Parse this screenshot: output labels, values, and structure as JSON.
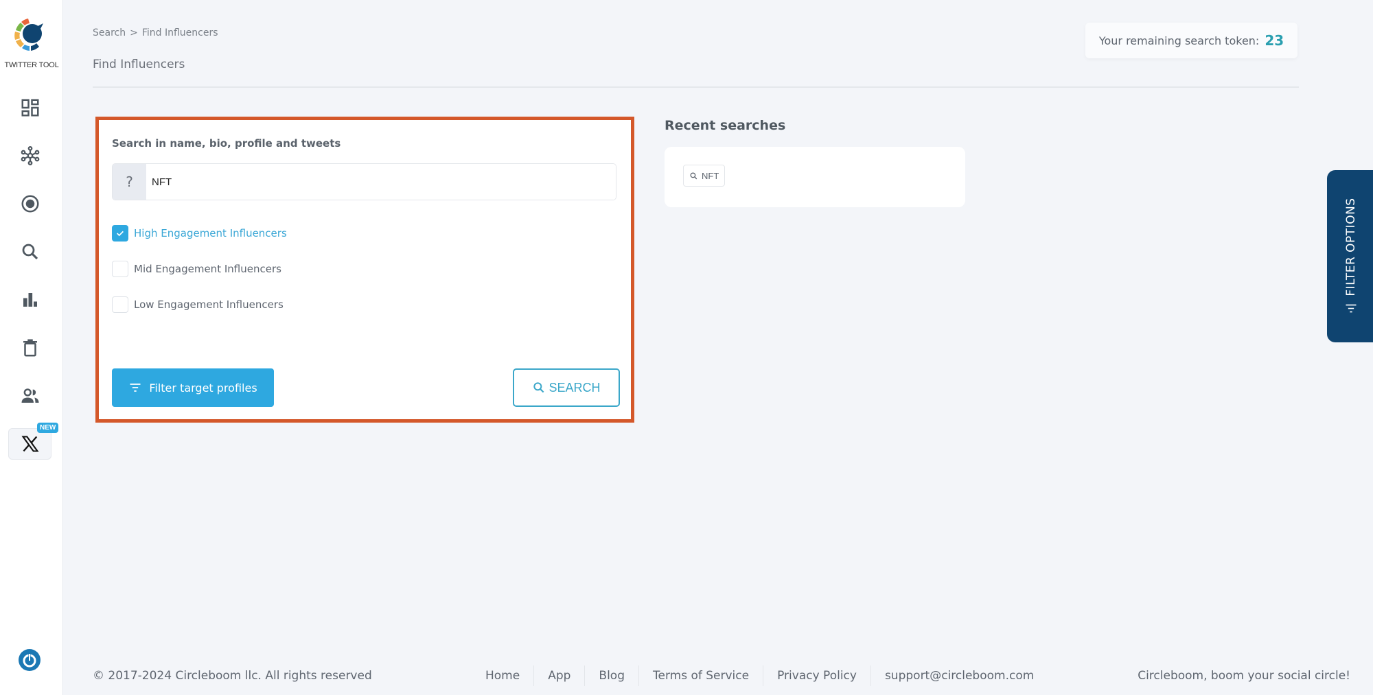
{
  "sidebar": {
    "logo_text": "TWITTER TOOL",
    "items": [
      {
        "icon": "dashboard-icon",
        "label": "Dashboard"
      },
      {
        "icon": "network-icon",
        "label": "Network"
      },
      {
        "icon": "target-icon",
        "label": "Target"
      },
      {
        "icon": "search-icon",
        "label": "Search"
      },
      {
        "icon": "bar-chart-icon",
        "label": "Analytics"
      },
      {
        "icon": "trash-icon",
        "label": "Delete"
      },
      {
        "icon": "users-icon",
        "label": "Users"
      }
    ],
    "x_badge": "NEW"
  },
  "header": {
    "breadcrumb": [
      "Search",
      "Find Influencers"
    ],
    "breadcrumb_sep": ">",
    "title": "Find Influencers",
    "token_label": "Your remaining search token:",
    "token_count": "23"
  },
  "search": {
    "label": "Search in name, bio, profile and tweets",
    "prefix": "?",
    "value": "NFT",
    "placeholder": "",
    "options": [
      {
        "label": "High Engagement Influencers",
        "checked": true
      },
      {
        "label": "Mid Engagement Influencers",
        "checked": false
      },
      {
        "label": "Low Engagement Influencers",
        "checked": false
      }
    ],
    "filter_button": "Filter target profiles",
    "search_button": "SEARCH"
  },
  "recent": {
    "title": "Recent searches",
    "items": [
      "NFT"
    ]
  },
  "filter_tab": {
    "label": "FILTER OPTIONS"
  },
  "footer": {
    "copyright": "© 2017-2024 Circleboom llc. All rights reserved",
    "links": [
      "Home",
      "App",
      "Blog",
      "Terms of Service",
      "Privacy Policy",
      "support@circleboom.com"
    ],
    "tagline": "Circleboom, boom your social circle!"
  },
  "colors": {
    "accent": "#2ea8e0",
    "highlight_border": "#d4582a",
    "filter_tab": "#0f4470",
    "token": "#2a9fb0"
  }
}
